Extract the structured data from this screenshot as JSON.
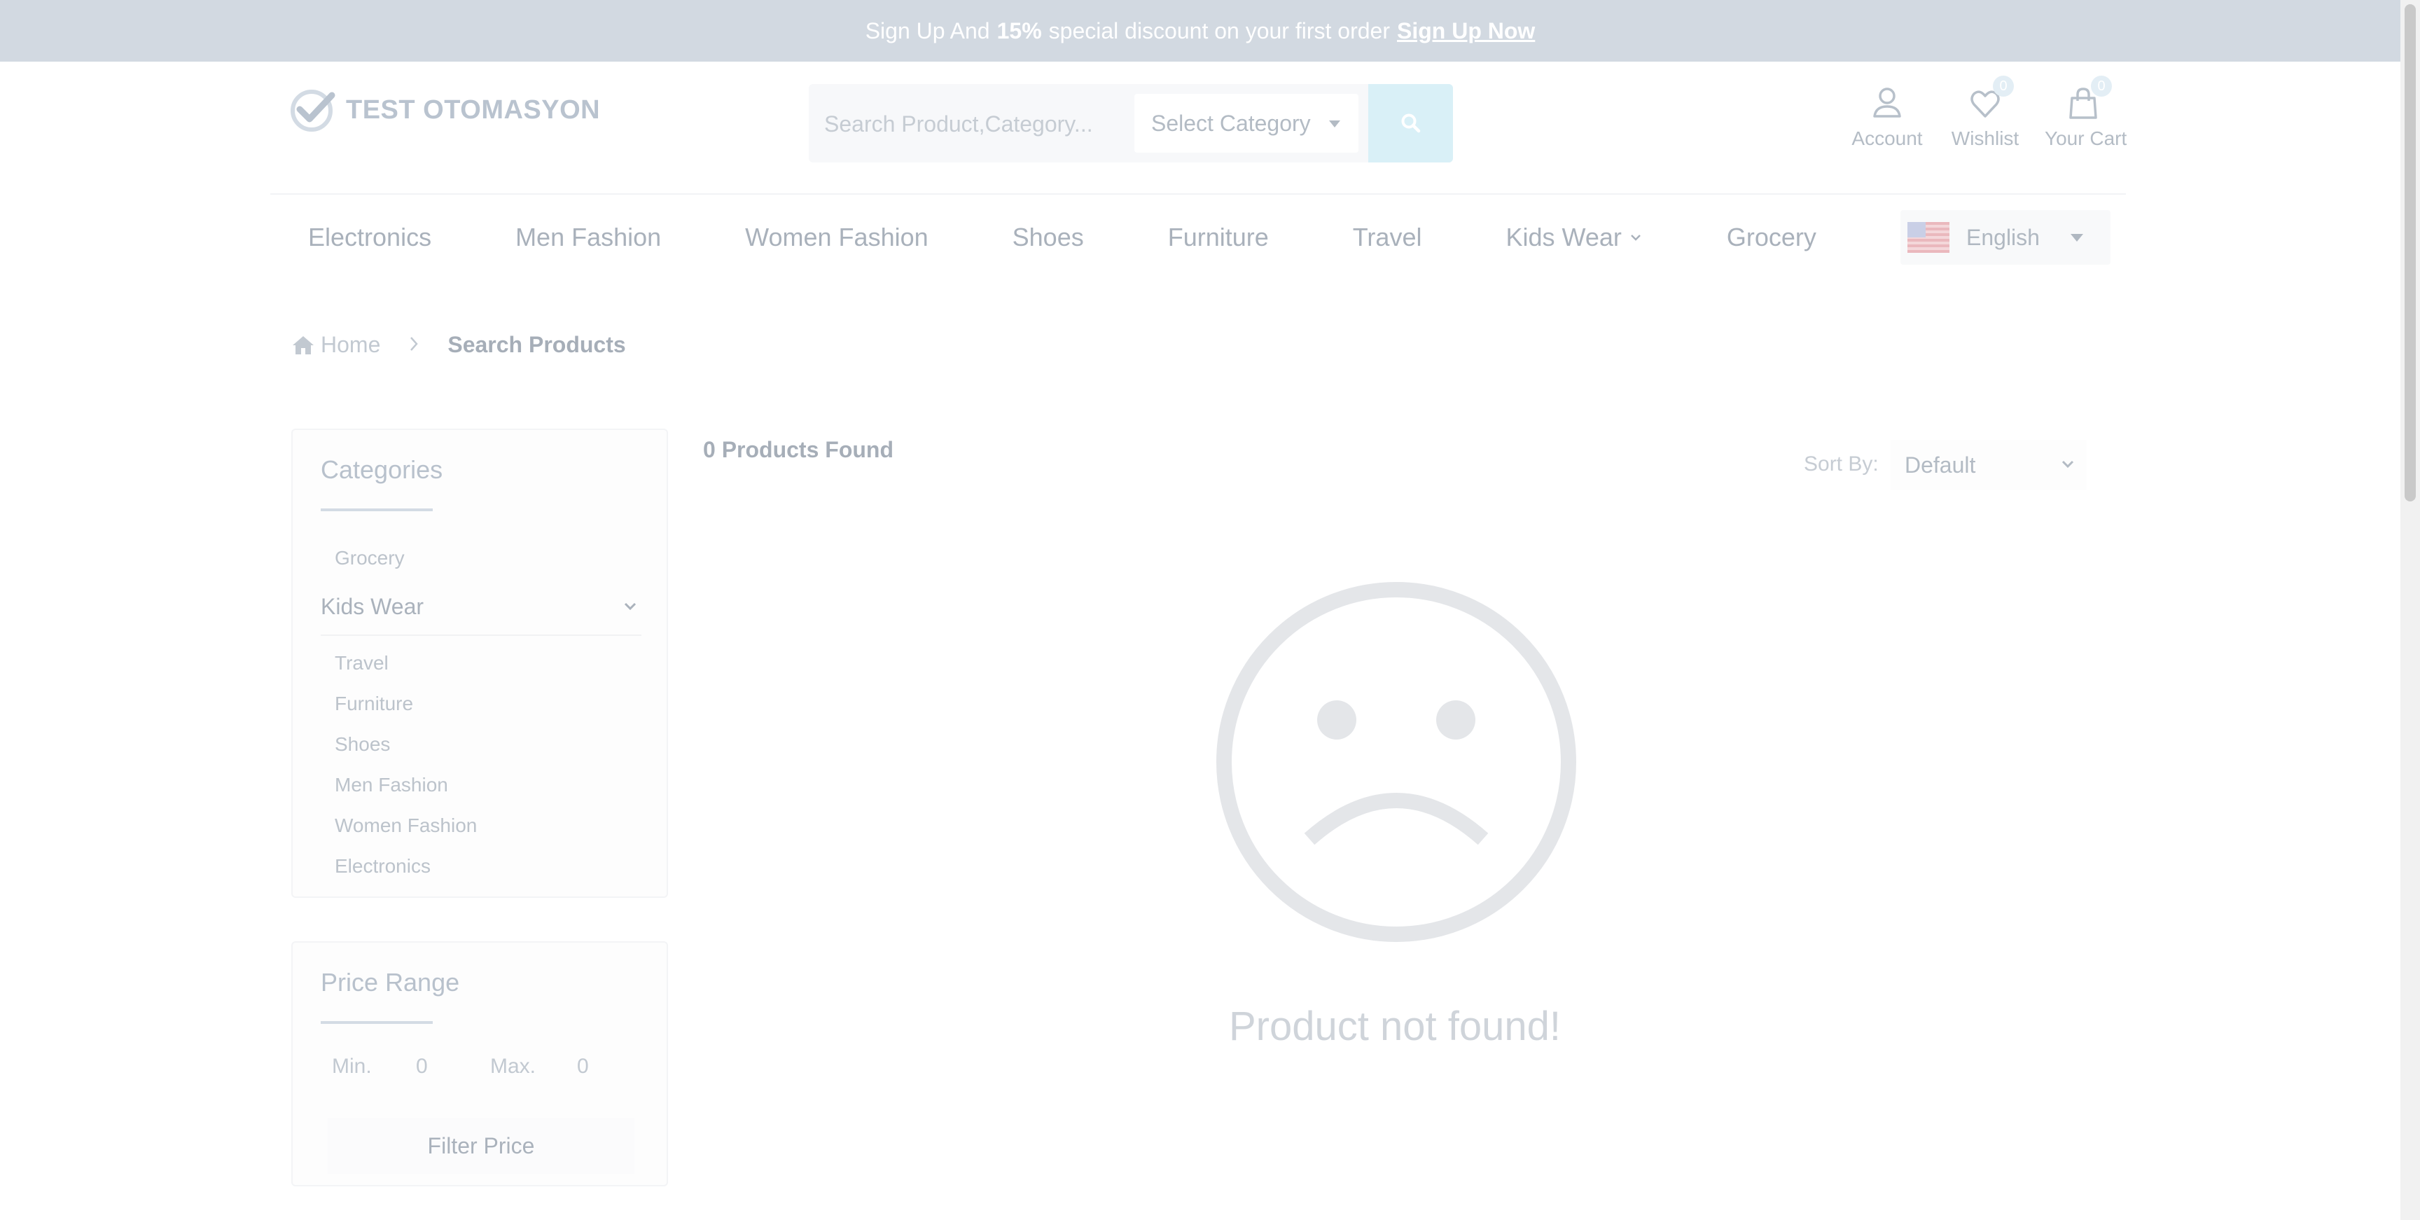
{
  "promo": {
    "text_before": "Sign Up And",
    "discount": "15%",
    "text_after": "special discount on your first order",
    "link": "Sign Up Now"
  },
  "header": {
    "logo_text": "TEST OTOMASYON",
    "search_placeholder": "Search Product,Category...",
    "category_select": "Select Category",
    "account_label": "Account",
    "wishlist_label": "Wishlist",
    "wishlist_count": "0",
    "cart_label": "Your Cart",
    "cart_count": "0"
  },
  "nav": {
    "items": [
      "Electronics",
      "Men Fashion",
      "Women Fashion",
      "Shoes",
      "Furniture",
      "Travel",
      "Kids Wear",
      "Grocery"
    ],
    "language": "English"
  },
  "breadcrumb": {
    "home": "Home",
    "current": "Search Products"
  },
  "sidebar": {
    "categories_title": "Categories",
    "categories": {
      "top": "Grocery",
      "group": "Kids Wear",
      "items": [
        "Travel",
        "Furniture",
        "Shoes",
        "Men Fashion",
        "Women Fashion",
        "Electronics"
      ]
    },
    "price_title": "Price Range",
    "min_label": "Min.",
    "min_value": "0",
    "max_label": "Max.",
    "max_value": "0",
    "filter_button": "Filter Price"
  },
  "main": {
    "found_text": "0 Products Found",
    "sort_label": "Sort By:",
    "sort_value": "Default",
    "empty_message": "Product not found!"
  },
  "colors": {
    "promo_bg": "#d2d9e1",
    "accent_button": "#d9f0f7",
    "muted_text": "#a6aeb8"
  }
}
